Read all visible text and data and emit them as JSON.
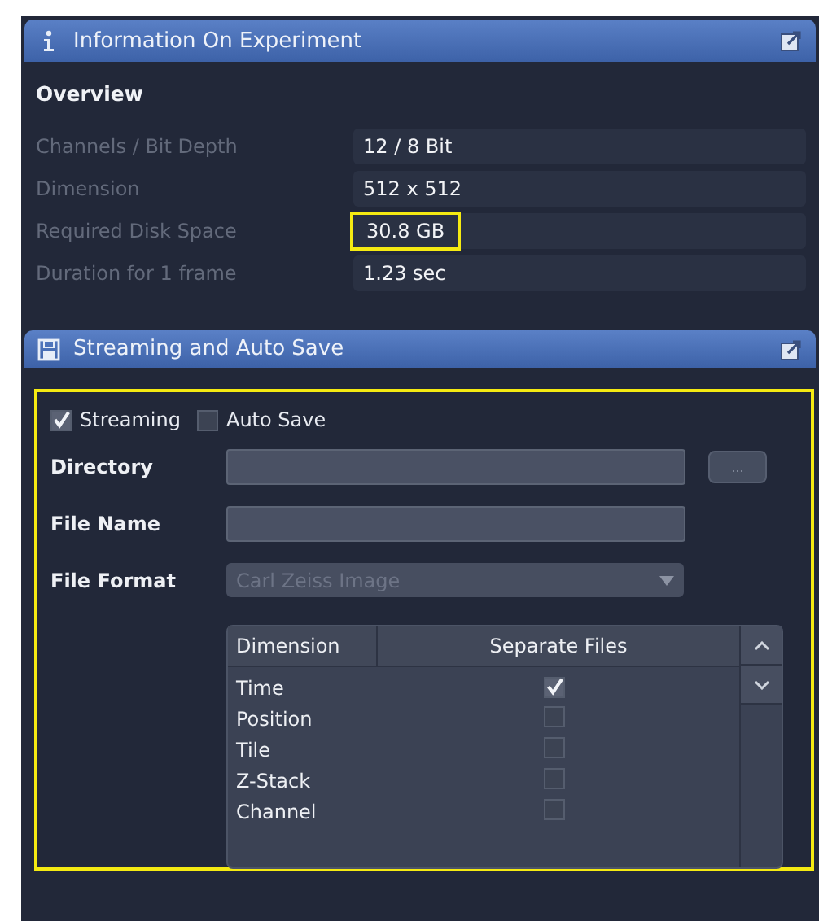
{
  "info_panel": {
    "title": "Information On Experiment",
    "section": "Overview",
    "rows": [
      {
        "label": "Channels / Bit Depth",
        "value": "12 / 8 Bit",
        "highlighted": false
      },
      {
        "label": "Dimension",
        "value": "512 x 512",
        "highlighted": false
      },
      {
        "label": "Required Disk Space",
        "value": "30.8 GB",
        "highlighted": true
      },
      {
        "label": "Duration for 1 frame",
        "value": "1.23 sec",
        "highlighted": false
      }
    ]
  },
  "streaming_panel": {
    "title": "Streaming and Auto Save",
    "highlighted": true,
    "options": [
      {
        "label": "Streaming",
        "checked": true
      },
      {
        "label": "Auto Save",
        "checked": false
      }
    ],
    "directory": {
      "label": "Directory",
      "browse_button": "..."
    },
    "file_name": {
      "label": "File Name"
    },
    "file_format": {
      "label": "File Format",
      "value": "Carl Zeiss Image",
      "disabled": true
    },
    "table": {
      "columns": [
        "Dimension",
        "Separate Files"
      ],
      "rows": [
        {
          "dimension": "Time",
          "checked": true
        },
        {
          "dimension": "Position",
          "checked": false
        },
        {
          "dimension": "Tile",
          "checked": false
        },
        {
          "dimension": "Z-Stack",
          "checked": false
        },
        {
          "dimension": "Channel",
          "checked": false
        }
      ]
    }
  }
}
